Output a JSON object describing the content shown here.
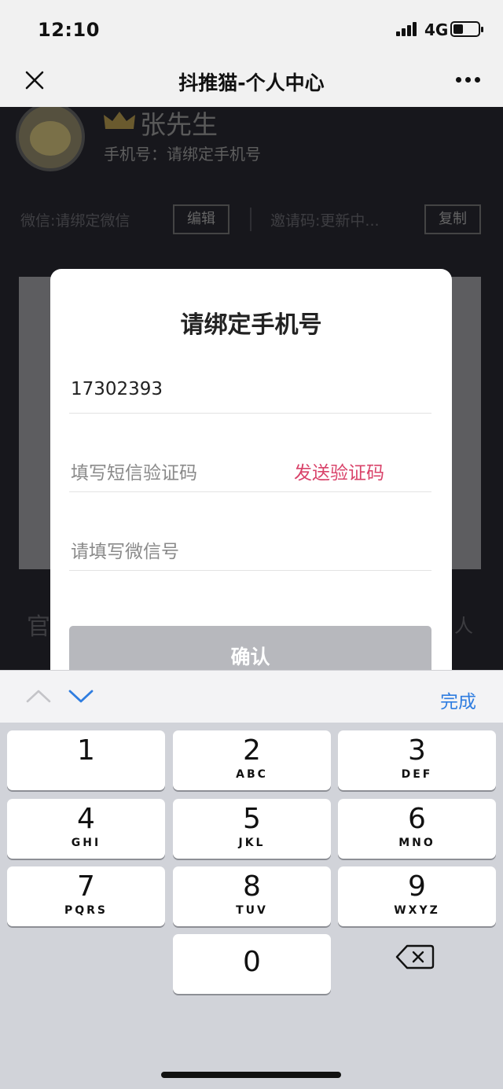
{
  "status_bar": {
    "time": "12:10",
    "network": "4G"
  },
  "nav": {
    "title": "抖推猫-个人中心",
    "close_icon": "close-icon",
    "more_icon": "more-icon"
  },
  "profile": {
    "name": "张先生",
    "phone_line": "手机号：请绑定手机号",
    "wechat_line": "微信:请绑定微信",
    "edit_label": "编辑",
    "invite_line": "邀请码:更新中...",
    "copy_label": "复制",
    "section_left": "官",
    "section_right": "人"
  },
  "modal": {
    "title": "请绑定手机号",
    "phone_value": "17302393",
    "code_placeholder": "填写短信验证码",
    "send_code_label": "发送验证码",
    "wechat_placeholder": "请填写微信号",
    "confirm_label": "确认"
  },
  "keyboard_toolbar": {
    "done_label": "完成"
  },
  "keypad": {
    "keys": [
      {
        "num": "1",
        "letters": ""
      },
      {
        "num": "2",
        "letters": "ABC"
      },
      {
        "num": "3",
        "letters": "DEF"
      },
      {
        "num": "4",
        "letters": "GHI"
      },
      {
        "num": "5",
        "letters": "JKL"
      },
      {
        "num": "6",
        "letters": "MNO"
      },
      {
        "num": "7",
        "letters": "PQRS"
      },
      {
        "num": "8",
        "letters": "TUV"
      },
      {
        "num": "9",
        "letters": "WXYZ"
      },
      {
        "num": "0",
        "letters": ""
      }
    ]
  },
  "colors": {
    "accent_red": "#d9436a",
    "done_blue": "#2f7de0",
    "confirm_disabled": "#b7b8bd"
  }
}
